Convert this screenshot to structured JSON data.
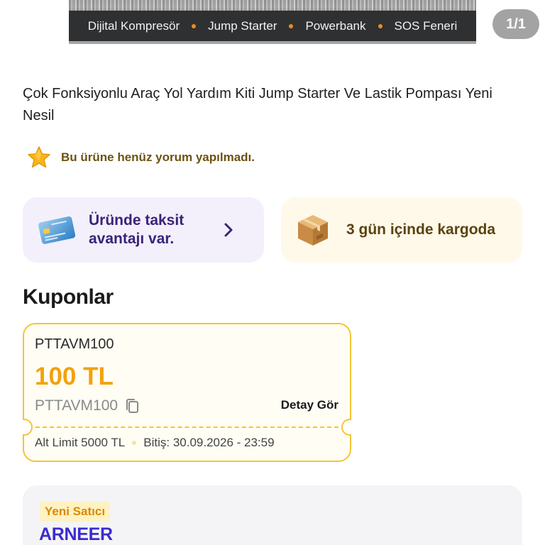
{
  "hero": {
    "features": [
      "Dijital Kompresör",
      "Jump Starter",
      "Powerbank",
      "SOS Feneri"
    ],
    "pager": "1/1"
  },
  "product": {
    "title": "Çok Fonksiyonlu Araç Yol Yardım Kiti Jump Starter Ve Lastik Pompası Yeni Nesil",
    "rating_text": "Bu ürüne henüz yorum yapılmadı."
  },
  "info_cards": {
    "taksit": "Üründe taksit avantajı var.",
    "kargo": "3 gün içinde kargoda"
  },
  "coupons": {
    "title": "Kuponlar",
    "items": [
      {
        "code": "PTTAVM100",
        "amount": "100 TL",
        "code_copy": "PTTAVM100",
        "detail_label": "Detay Gör",
        "limit": "Alt Limit 5000 TL",
        "expiry": "Bitiş: 30.09.2026 - 23:59"
      }
    ]
  },
  "seller": {
    "badge": "Yeni Satıcı",
    "name": "ARNEER"
  },
  "colors": {
    "accent_purple": "#3a2379",
    "coupon_border": "#f4c533",
    "coupon_amount": "#f2a20c",
    "seller_name": "#3b2bd0"
  }
}
